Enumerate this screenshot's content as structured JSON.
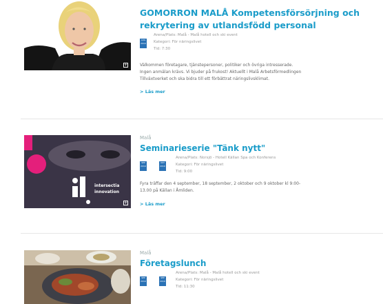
{
  "events": [
    {
      "municipality": "",
      "title_line1": "GOMORRON MALÅ Kompetensförsörjning och",
      "title_line2": "rekrytering av utlandsfödd personal",
      "venue": "Arena/Plats: Malå - Malå hotell och ski event",
      "category": "Kategori: För näringslivet",
      "time": "Tid: 7:30",
      "description_lines": [
        "Välkommen företagare, tjänstepersoner, politiker och övriga intresserade.",
        "Ingen anmälan krävs. Vi bjuder på frukost! Aktuellt i Malå Arbetsförmedlingen",
        "Tillväxtverket och ska bidra till ett förbättrat näringslivsklimat."
      ],
      "read_more": "> Läs mer",
      "date_badges": [
        "AUG 2019"
      ]
    },
    {
      "municipality": "Malå",
      "title": "Seminarieserie \"Tänk nytt\"",
      "venue": "Arena/Plats: Norsjö - Hotell Källan Spa och Konferens",
      "category": "Kategori: För näringslivet",
      "time": "Tid: 9:00",
      "description_lines": [
        "Fyra träffar den 4 september, 18 september, 2 oktober och 9 oktober kl 9:00-",
        "13.00 på Källan i Åmliden."
      ],
      "read_more": "> Läs mer",
      "image_text": [
        "intersectia",
        "innovation"
      ],
      "date_badges": [
        "SEP 2019",
        "OKT 2019"
      ]
    },
    {
      "municipality": "Malå",
      "title": "Företagslunch",
      "venue": "Arena/Plats: Malå - Malå hotell och ski event",
      "category": "Kategori: För näringslivet",
      "time": "Tid: 11:30",
      "date_badges": [
        "SEP 2019",
        "SEP 2019"
      ]
    }
  ]
}
